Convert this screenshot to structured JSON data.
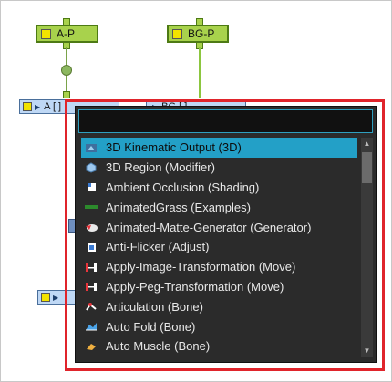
{
  "nodes": {
    "peg_a": "A-P",
    "peg_bg": "BG-P",
    "node_a": "A [ ]",
    "node_bg": "BG [ ]"
  },
  "search": {
    "value": ""
  },
  "menu": {
    "items": [
      {
        "label": "3D Kinematic Output (3D)",
        "icon": "kinematic-output-icon",
        "selected": true
      },
      {
        "label": "3D Region (Modifier)",
        "icon": "region-icon"
      },
      {
        "label": "Ambient Occlusion (Shading)",
        "icon": "ambient-occlusion-icon"
      },
      {
        "label": "AnimatedGrass (Examples)",
        "icon": "grass-icon"
      },
      {
        "label": "Animated-Matte-Generator (Generator)",
        "icon": "matte-generator-icon"
      },
      {
        "label": "Anti-Flicker (Adjust)",
        "icon": "anti-flicker-icon"
      },
      {
        "label": "Apply-Image-Transformation (Move)",
        "icon": "image-transform-icon"
      },
      {
        "label": "Apply-Peg-Transformation (Move)",
        "icon": "peg-transform-icon"
      },
      {
        "label": "Articulation (Bone)",
        "icon": "articulation-icon"
      },
      {
        "label": "Auto Fold (Bone)",
        "icon": "auto-fold-icon"
      },
      {
        "label": "Auto Muscle (Bone)",
        "icon": "auto-muscle-icon"
      }
    ]
  },
  "colors": {
    "highlight": "#e0242b",
    "selection": "#23a0c7",
    "peg": "#a8d24c"
  }
}
